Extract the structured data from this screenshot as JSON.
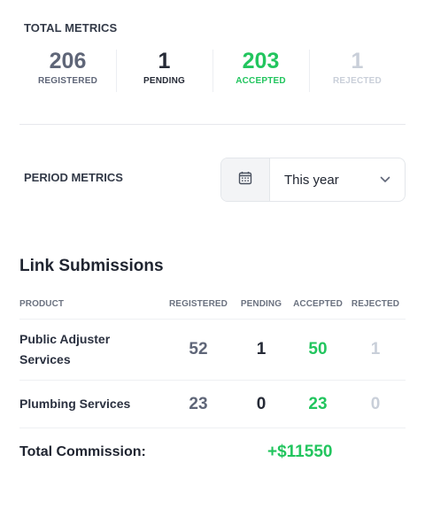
{
  "total_metrics": {
    "title": "TOTAL METRICS",
    "items": [
      {
        "value": "206",
        "label": "REGISTERED"
      },
      {
        "value": "1",
        "label": "PENDING"
      },
      {
        "value": "203",
        "label": "ACCEPTED"
      },
      {
        "value": "1",
        "label": "REJECTED"
      }
    ]
  },
  "period_metrics": {
    "title": "PERIOD METRICS",
    "selected": "This year",
    "icons": {
      "calendar": "calendar-icon",
      "chevron": "chevron-down-icon"
    }
  },
  "link_submissions": {
    "title": "Link Submissions",
    "columns": [
      "PRODUCT",
      "REGISTERED",
      "PENDING",
      "ACCEPTED",
      "REJECTED"
    ],
    "rows": [
      {
        "product_line1": "Public Adjuster",
        "product_line2": "Services",
        "registered": "52",
        "pending": "1",
        "accepted": "50",
        "rejected": "1"
      },
      {
        "product_line1": "Plumbing Services",
        "product_line2": "",
        "registered": "23",
        "pending": "0",
        "accepted": "23",
        "rejected": "0"
      }
    ],
    "total_label": "Total Commission:",
    "total_value": "+$11550"
  },
  "colors": {
    "accepted": "#22c55e",
    "registered": "#5f6678",
    "pending": "#252a36",
    "rejected": "#c9cfd9"
  }
}
